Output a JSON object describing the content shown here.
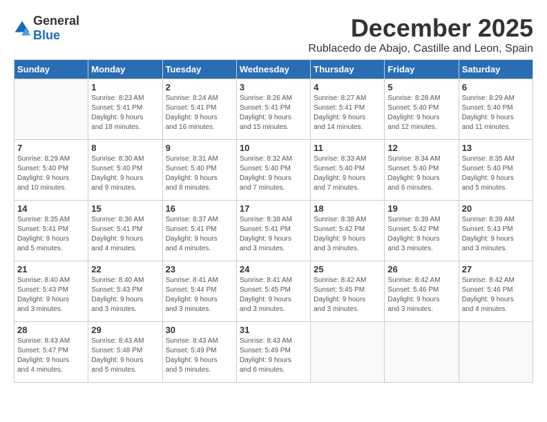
{
  "header": {
    "logo_general": "General",
    "logo_blue": "Blue",
    "month": "December 2025",
    "location": "Rublacedo de Abajo, Castille and Leon, Spain"
  },
  "calendar": {
    "days_of_week": [
      "Sunday",
      "Monday",
      "Tuesday",
      "Wednesday",
      "Thursday",
      "Friday",
      "Saturday"
    ],
    "weeks": [
      [
        {
          "day": "",
          "info": ""
        },
        {
          "day": "1",
          "info": "Sunrise: 8:23 AM\nSunset: 5:41 PM\nDaylight: 9 hours\nand 18 minutes."
        },
        {
          "day": "2",
          "info": "Sunrise: 8:24 AM\nSunset: 5:41 PM\nDaylight: 9 hours\nand 16 minutes."
        },
        {
          "day": "3",
          "info": "Sunrise: 8:26 AM\nSunset: 5:41 PM\nDaylight: 9 hours\nand 15 minutes."
        },
        {
          "day": "4",
          "info": "Sunrise: 8:27 AM\nSunset: 5:41 PM\nDaylight: 9 hours\nand 14 minutes."
        },
        {
          "day": "5",
          "info": "Sunrise: 8:28 AM\nSunset: 5:40 PM\nDaylight: 9 hours\nand 12 minutes."
        },
        {
          "day": "6",
          "info": "Sunrise: 8:29 AM\nSunset: 5:40 PM\nDaylight: 9 hours\nand 11 minutes."
        }
      ],
      [
        {
          "day": "7",
          "info": "Sunrise: 8:29 AM\nSunset: 5:40 PM\nDaylight: 9 hours\nand 10 minutes."
        },
        {
          "day": "8",
          "info": "Sunrise: 8:30 AM\nSunset: 5:40 PM\nDaylight: 9 hours\nand 9 minutes."
        },
        {
          "day": "9",
          "info": "Sunrise: 8:31 AM\nSunset: 5:40 PM\nDaylight: 9 hours\nand 8 minutes."
        },
        {
          "day": "10",
          "info": "Sunrise: 8:32 AM\nSunset: 5:40 PM\nDaylight: 9 hours\nand 7 minutes."
        },
        {
          "day": "11",
          "info": "Sunrise: 8:33 AM\nSunset: 5:40 PM\nDaylight: 9 hours\nand 7 minutes."
        },
        {
          "day": "12",
          "info": "Sunrise: 8:34 AM\nSunset: 5:40 PM\nDaylight: 9 hours\nand 6 minutes."
        },
        {
          "day": "13",
          "info": "Sunrise: 8:35 AM\nSunset: 5:40 PM\nDaylight: 9 hours\nand 5 minutes."
        }
      ],
      [
        {
          "day": "14",
          "info": "Sunrise: 8:35 AM\nSunset: 5:41 PM\nDaylight: 9 hours\nand 5 minutes."
        },
        {
          "day": "15",
          "info": "Sunrise: 8:36 AM\nSunset: 5:41 PM\nDaylight: 9 hours\nand 4 minutes."
        },
        {
          "day": "16",
          "info": "Sunrise: 8:37 AM\nSunset: 5:41 PM\nDaylight: 9 hours\nand 4 minutes."
        },
        {
          "day": "17",
          "info": "Sunrise: 8:38 AM\nSunset: 5:41 PM\nDaylight: 9 hours\nand 3 minutes."
        },
        {
          "day": "18",
          "info": "Sunrise: 8:38 AM\nSunset: 5:42 PM\nDaylight: 9 hours\nand 3 minutes."
        },
        {
          "day": "19",
          "info": "Sunrise: 8:39 AM\nSunset: 5:42 PM\nDaylight: 9 hours\nand 3 minutes."
        },
        {
          "day": "20",
          "info": "Sunrise: 8:39 AM\nSunset: 5:43 PM\nDaylight: 9 hours\nand 3 minutes."
        }
      ],
      [
        {
          "day": "21",
          "info": "Sunrise: 8:40 AM\nSunset: 5:43 PM\nDaylight: 9 hours\nand 3 minutes."
        },
        {
          "day": "22",
          "info": "Sunrise: 8:40 AM\nSunset: 5:43 PM\nDaylight: 9 hours\nand 3 minutes."
        },
        {
          "day": "23",
          "info": "Sunrise: 8:41 AM\nSunset: 5:44 PM\nDaylight: 9 hours\nand 3 minutes."
        },
        {
          "day": "24",
          "info": "Sunrise: 8:41 AM\nSunset: 5:45 PM\nDaylight: 9 hours\nand 3 minutes."
        },
        {
          "day": "25",
          "info": "Sunrise: 8:42 AM\nSunset: 5:45 PM\nDaylight: 9 hours\nand 3 minutes."
        },
        {
          "day": "26",
          "info": "Sunrise: 8:42 AM\nSunset: 5:46 PM\nDaylight: 9 hours\nand 3 minutes."
        },
        {
          "day": "27",
          "info": "Sunrise: 8:42 AM\nSunset: 5:46 PM\nDaylight: 9 hours\nand 4 minutes."
        }
      ],
      [
        {
          "day": "28",
          "info": "Sunrise: 8:43 AM\nSunset: 5:47 PM\nDaylight: 9 hours\nand 4 minutes."
        },
        {
          "day": "29",
          "info": "Sunrise: 8:43 AM\nSunset: 5:48 PM\nDaylight: 9 hours\nand 5 minutes."
        },
        {
          "day": "30",
          "info": "Sunrise: 8:43 AM\nSunset: 5:49 PM\nDaylight: 9 hours\nand 5 minutes."
        },
        {
          "day": "31",
          "info": "Sunrise: 8:43 AM\nSunset: 5:49 PM\nDaylight: 9 hours\nand 6 minutes."
        },
        {
          "day": "",
          "info": ""
        },
        {
          "day": "",
          "info": ""
        },
        {
          "day": "",
          "info": ""
        }
      ]
    ]
  }
}
